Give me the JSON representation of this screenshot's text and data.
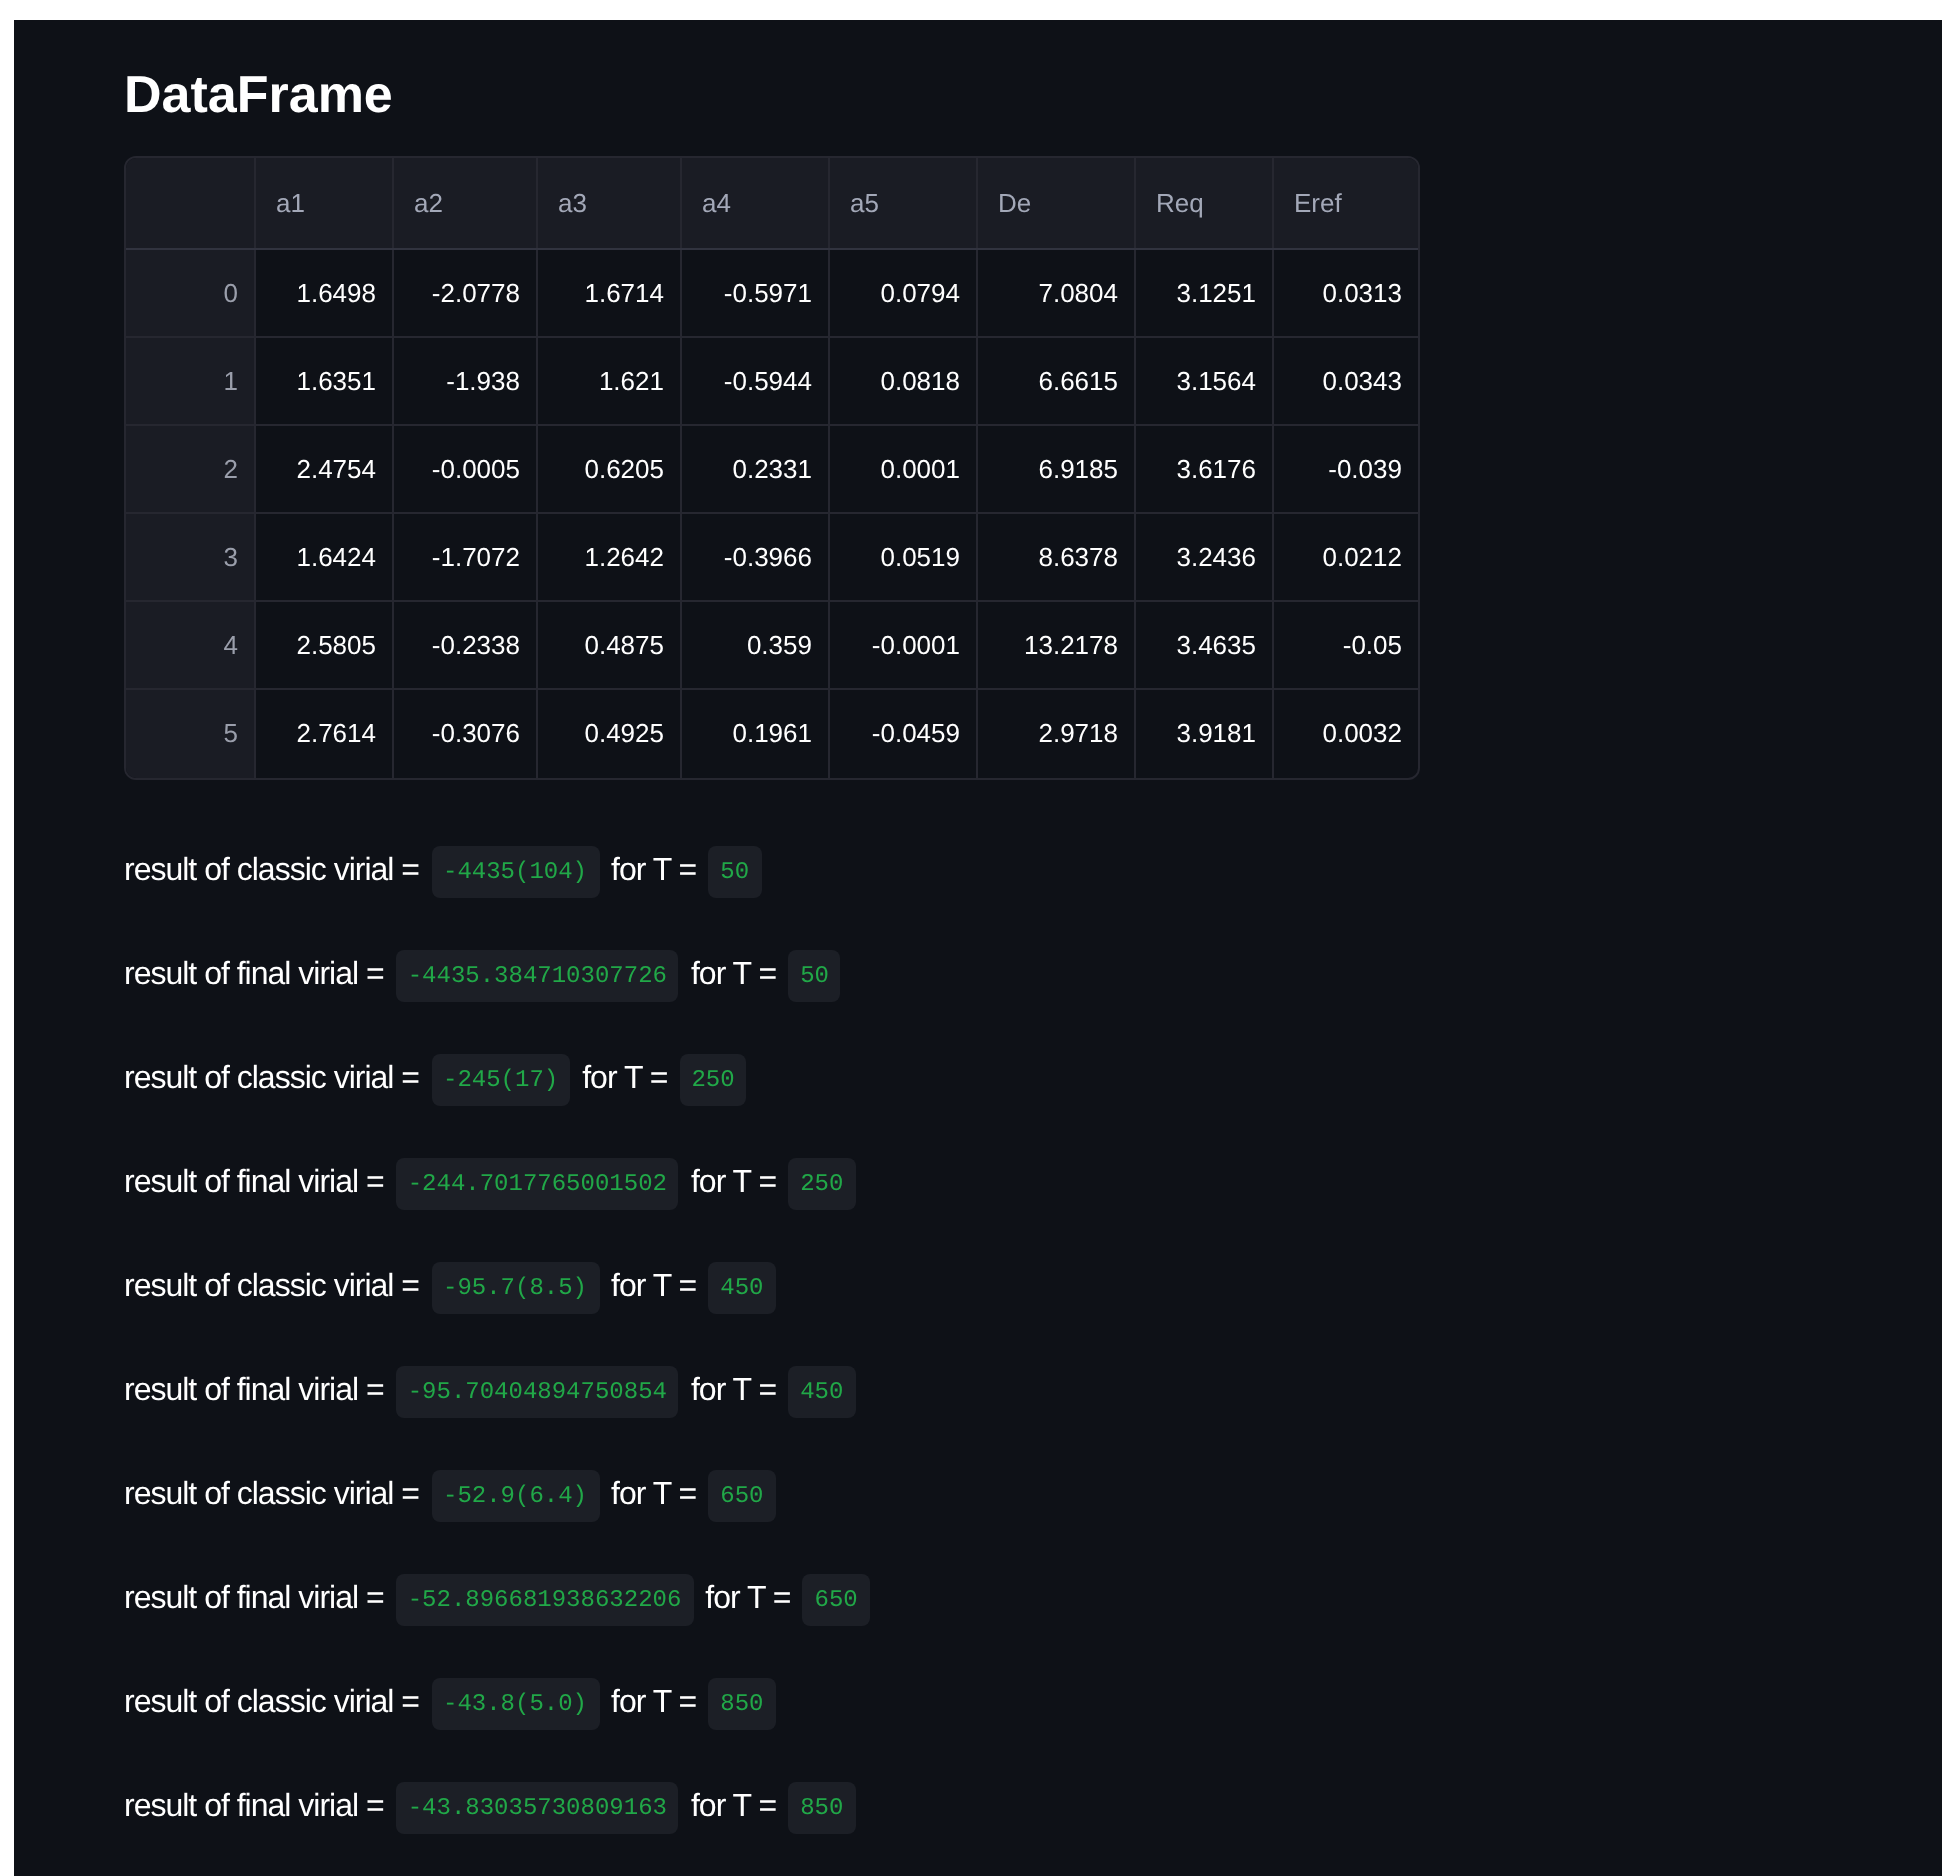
{
  "heading": "DataFrame",
  "table": {
    "columns": [
      "",
      "a1",
      "a2",
      "a3",
      "a4",
      "a5",
      "De",
      "Req",
      "Eref"
    ],
    "rows": [
      [
        "0",
        "1.6498",
        "-2.0778",
        "1.6714",
        "-0.5971",
        "0.0794",
        "7.0804",
        "3.1251",
        "0.0313"
      ],
      [
        "1",
        "1.6351",
        "-1.938",
        "1.621",
        "-0.5944",
        "0.0818",
        "6.6615",
        "3.1564",
        "0.0343"
      ],
      [
        "2",
        "2.4754",
        "-0.0005",
        "0.6205",
        "0.2331",
        "0.0001",
        "6.9185",
        "3.6176",
        "-0.039"
      ],
      [
        "3",
        "1.6424",
        "-1.7072",
        "1.2642",
        "-0.3966",
        "0.0519",
        "8.6378",
        "3.2436",
        "0.0212"
      ],
      [
        "4",
        "2.5805",
        "-0.2338",
        "0.4875",
        "0.359",
        "-0.0001",
        "13.2178",
        "3.4635",
        "-0.05"
      ],
      [
        "5",
        "2.7614",
        "-0.3076",
        "0.4925",
        "0.1961",
        "-0.0459",
        "2.9718",
        "3.9181",
        "0.0032"
      ]
    ]
  },
  "results": [
    {
      "label": "result of classic virial =",
      "value": "-4435(104)",
      "for_label": "for T =",
      "t": "50"
    },
    {
      "label": "result of final virial =",
      "value": "-4435.384710307726",
      "for_label": "for T =",
      "t": "50"
    },
    {
      "label": "result of classic virial =",
      "value": "-245(17)",
      "for_label": "for T =",
      "t": "250"
    },
    {
      "label": "result of final virial =",
      "value": "-244.7017765001502",
      "for_label": "for T =",
      "t": "250"
    },
    {
      "label": "result of classic virial =",
      "value": "-95.7(8.5)",
      "for_label": "for T =",
      "t": "450"
    },
    {
      "label": "result of final virial =",
      "value": "-95.70404894750854",
      "for_label": "for T =",
      "t": "450"
    },
    {
      "label": "result of classic virial =",
      "value": "-52.9(6.4)",
      "for_label": "for T =",
      "t": "650"
    },
    {
      "label": "result of final virial =",
      "value": "-52.896681938632206",
      "for_label": "for T =",
      "t": "650"
    },
    {
      "label": "result of classic virial =",
      "value": "-43.8(5.0)",
      "for_label": "for T =",
      "t": "850"
    },
    {
      "label": "result of final virial =",
      "value": "-43.83035730809163",
      "for_label": "for T =",
      "t": "850"
    }
  ]
}
